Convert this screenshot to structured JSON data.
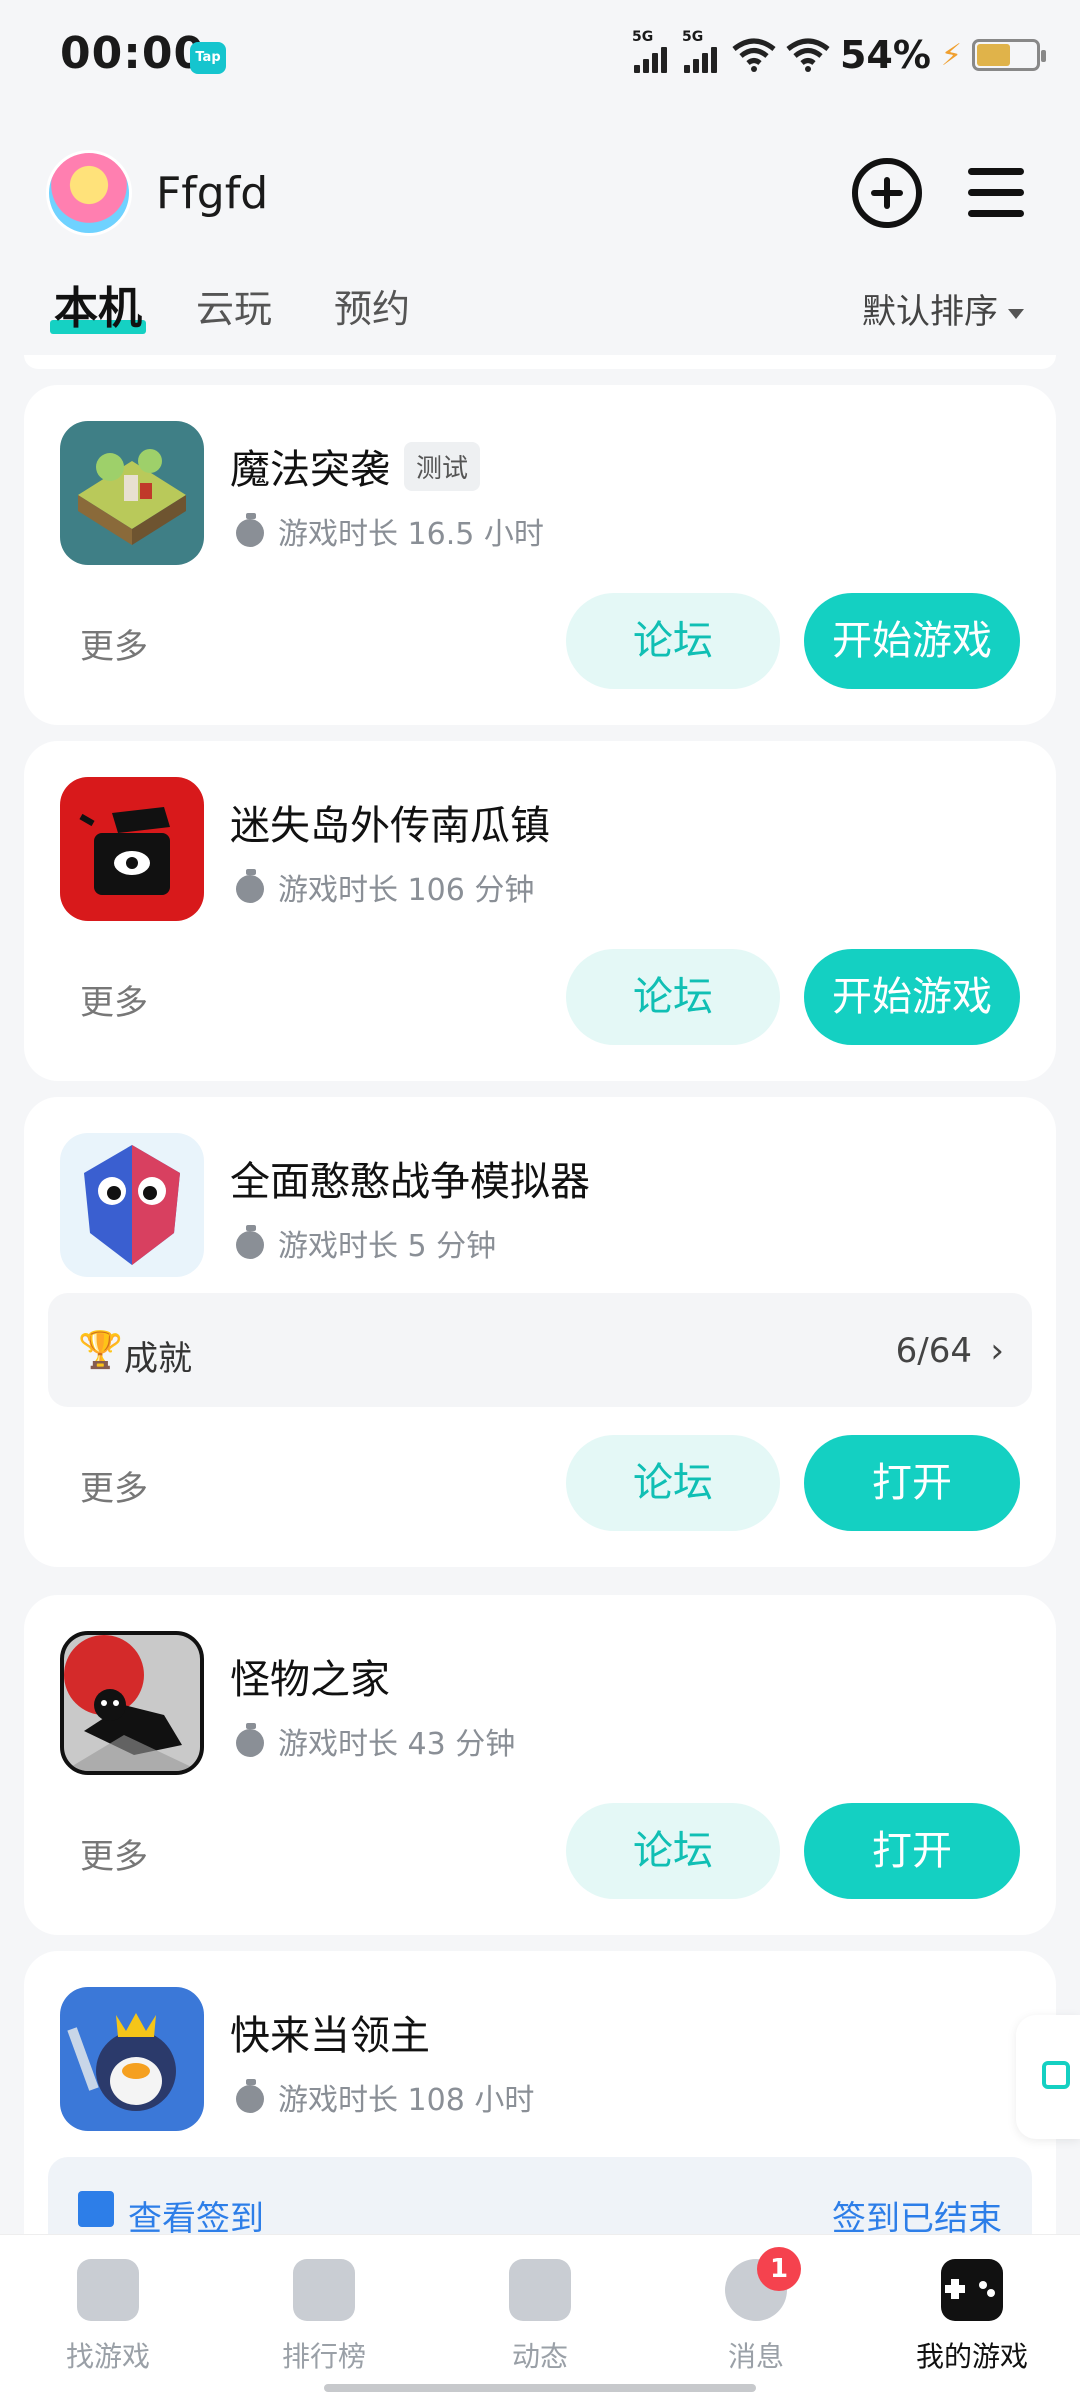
{
  "status_bar": {
    "time": "00:00",
    "tap_badge": "Tap",
    "network_1": "5G",
    "network_2": "5G",
    "battery": "54%"
  },
  "header": {
    "username": "Ffgfd"
  },
  "tabs": [
    {
      "label": "本机"
    },
    {
      "label": "云玩"
    },
    {
      "label": "预约"
    }
  ],
  "sort": {
    "label": "默认排序"
  },
  "games": [
    {
      "name": "魔法突袭",
      "tag": "测试",
      "playtime": "游戏时长 16.5 小时",
      "more": "更多",
      "forum": "论坛",
      "action": "开始游戏"
    },
    {
      "name": "迷失岛外传南瓜镇",
      "playtime": "游戏时长 106 分钟",
      "more": "更多",
      "forum": "论坛",
      "action": "开始游戏"
    },
    {
      "name": "全面憨憨战争模拟器",
      "playtime": "游戏时长 5 分钟",
      "achievement_label": "成就",
      "achievement_count": "6/64",
      "more": "更多",
      "forum": "论坛",
      "action": "打开"
    },
    {
      "name": "怪物之家",
      "playtime": "游戏时长 43 分钟",
      "more": "更多",
      "forum": "论坛",
      "action": "打开"
    },
    {
      "name": "快来当领主",
      "playtime": "游戏时长 108 小时",
      "signin_label": "查看签到",
      "signin_status": "签到已结束"
    }
  ],
  "bottom_nav": [
    {
      "label": "找游戏"
    },
    {
      "label": "排行榜"
    },
    {
      "label": "动态"
    },
    {
      "label": "消息",
      "badge": "1"
    },
    {
      "label": "我的游戏"
    }
  ],
  "colors": {
    "accent": "#14d0c2",
    "forum_bg": "#e4f8f6",
    "badge_red": "#f5424e",
    "link_blue": "#2d7ee8"
  }
}
